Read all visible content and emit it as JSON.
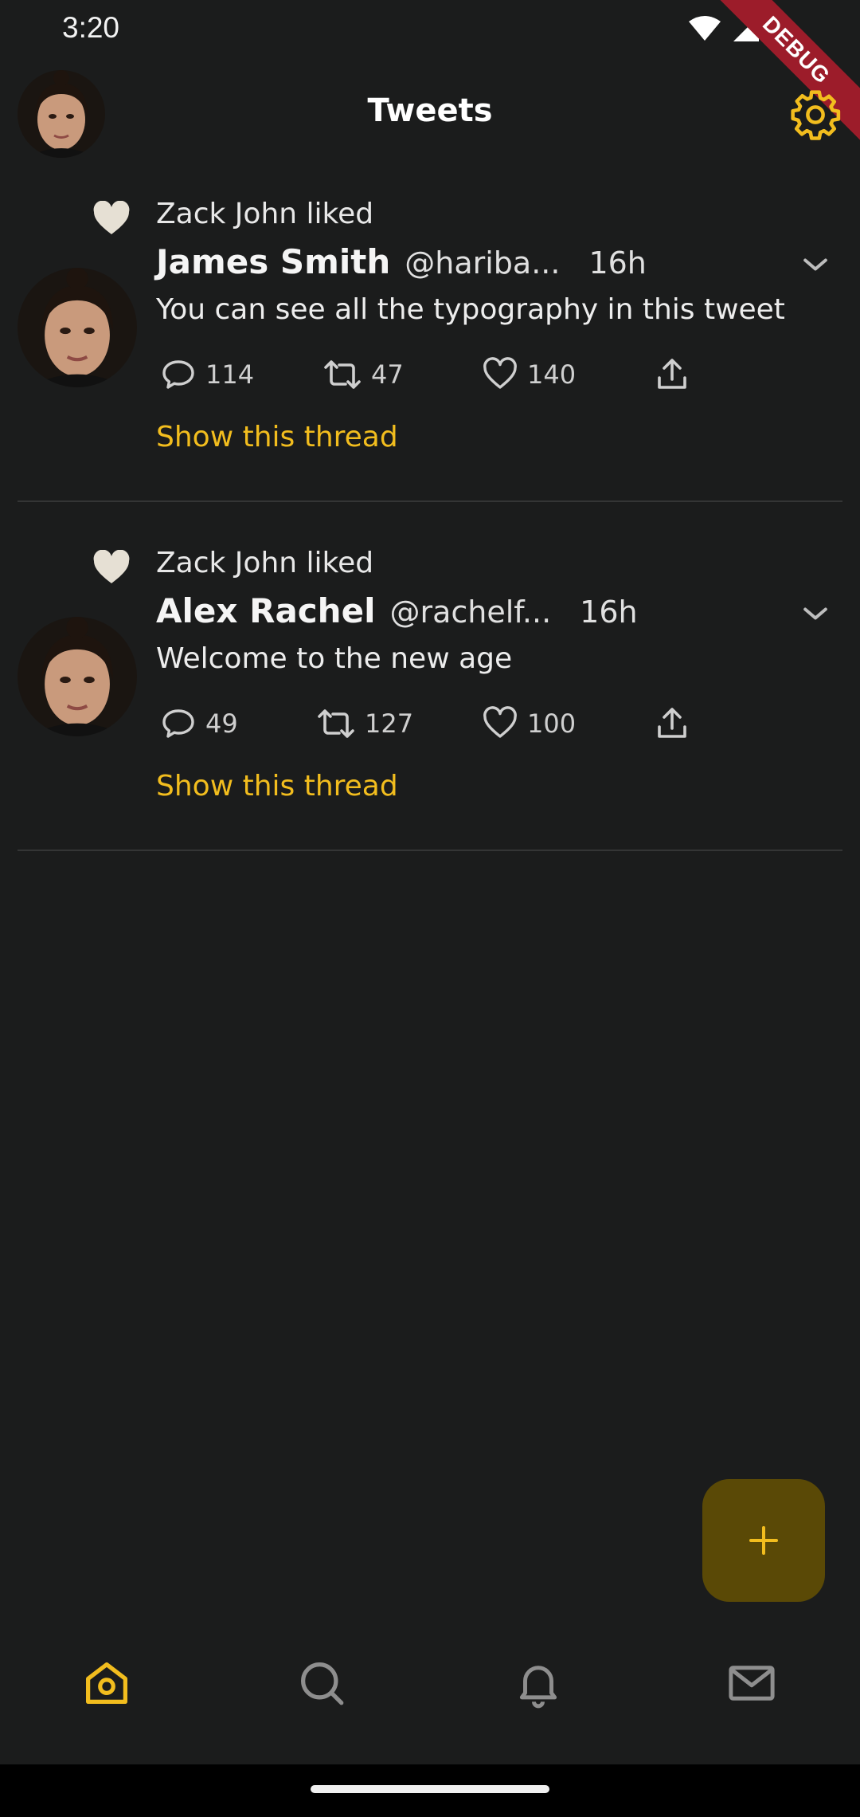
{
  "status_bar": {
    "time": "3:20",
    "debug_label": "DEBUG"
  },
  "app_bar": {
    "title": "Tweets",
    "settings_icon": "gear-icon"
  },
  "tweets": [
    {
      "liked_by": "Zack John liked",
      "author": "James Smith",
      "handle": "@hariba...",
      "time": "16h",
      "text": "You can see all the typography in this tweet",
      "replies": "114",
      "retweets": "47",
      "likes": "140",
      "thread_link": "Show this thread"
    },
    {
      "liked_by": "Zack John liked",
      "author": "Alex Rachel",
      "handle": "@rachelf...",
      "time": "16h",
      "text": "Welcome to the new age",
      "replies": "49",
      "retweets": "127",
      "likes": "100",
      "thread_link": "Show this thread"
    }
  ],
  "bottom_nav": [
    "home-icon",
    "search-icon",
    "bell-icon",
    "mail-icon"
  ],
  "colors": {
    "accent": "#f2bd1e",
    "background": "#1b1c1c",
    "fab": "#5a4906"
  }
}
